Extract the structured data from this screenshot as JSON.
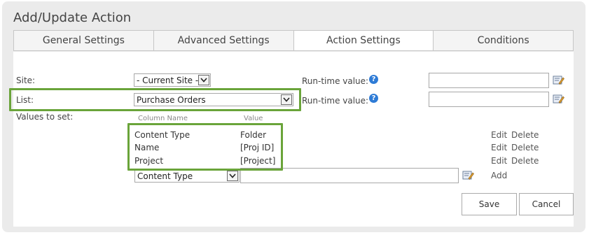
{
  "dialog": {
    "title": "Add/Update Action"
  },
  "tabs": [
    {
      "label": "General Settings",
      "active": false
    },
    {
      "label": "Advanced Settings",
      "active": false
    },
    {
      "label": "Action Settings",
      "active": true
    },
    {
      "label": "Conditions",
      "active": false
    }
  ],
  "form": {
    "site_label": "Site:",
    "site_value": "- Current Site -",
    "list_label": "List:",
    "list_value": "Purchase Orders",
    "runtime_label": "Run-time value:",
    "help_glyph": "?",
    "values_label": "Values to set:"
  },
  "values_table": {
    "header_column": "Column Name",
    "header_value": "Value",
    "rows": [
      {
        "column": "Content Type",
        "value": "Folder",
        "edit": "Edit",
        "delete": "Delete"
      },
      {
        "column": "Name",
        "value": "[Proj ID]",
        "edit": "Edit",
        "delete": "Delete"
      },
      {
        "column": "Project",
        "value": "[Project]",
        "edit": "Edit",
        "delete": "Delete"
      }
    ],
    "new_row": {
      "column_select": "Content Type",
      "value_input": "",
      "add_label": "Add"
    }
  },
  "buttons": {
    "save": "Save",
    "cancel": "Cancel"
  },
  "colors": {
    "highlight": "#6aa43a",
    "help_icon": "#2e7bd6",
    "panel": "#ebebeb"
  },
  "icons": {
    "help": "help-icon",
    "picker": "lookup-picker-icon",
    "dropdown": "chevron-down-icon"
  }
}
